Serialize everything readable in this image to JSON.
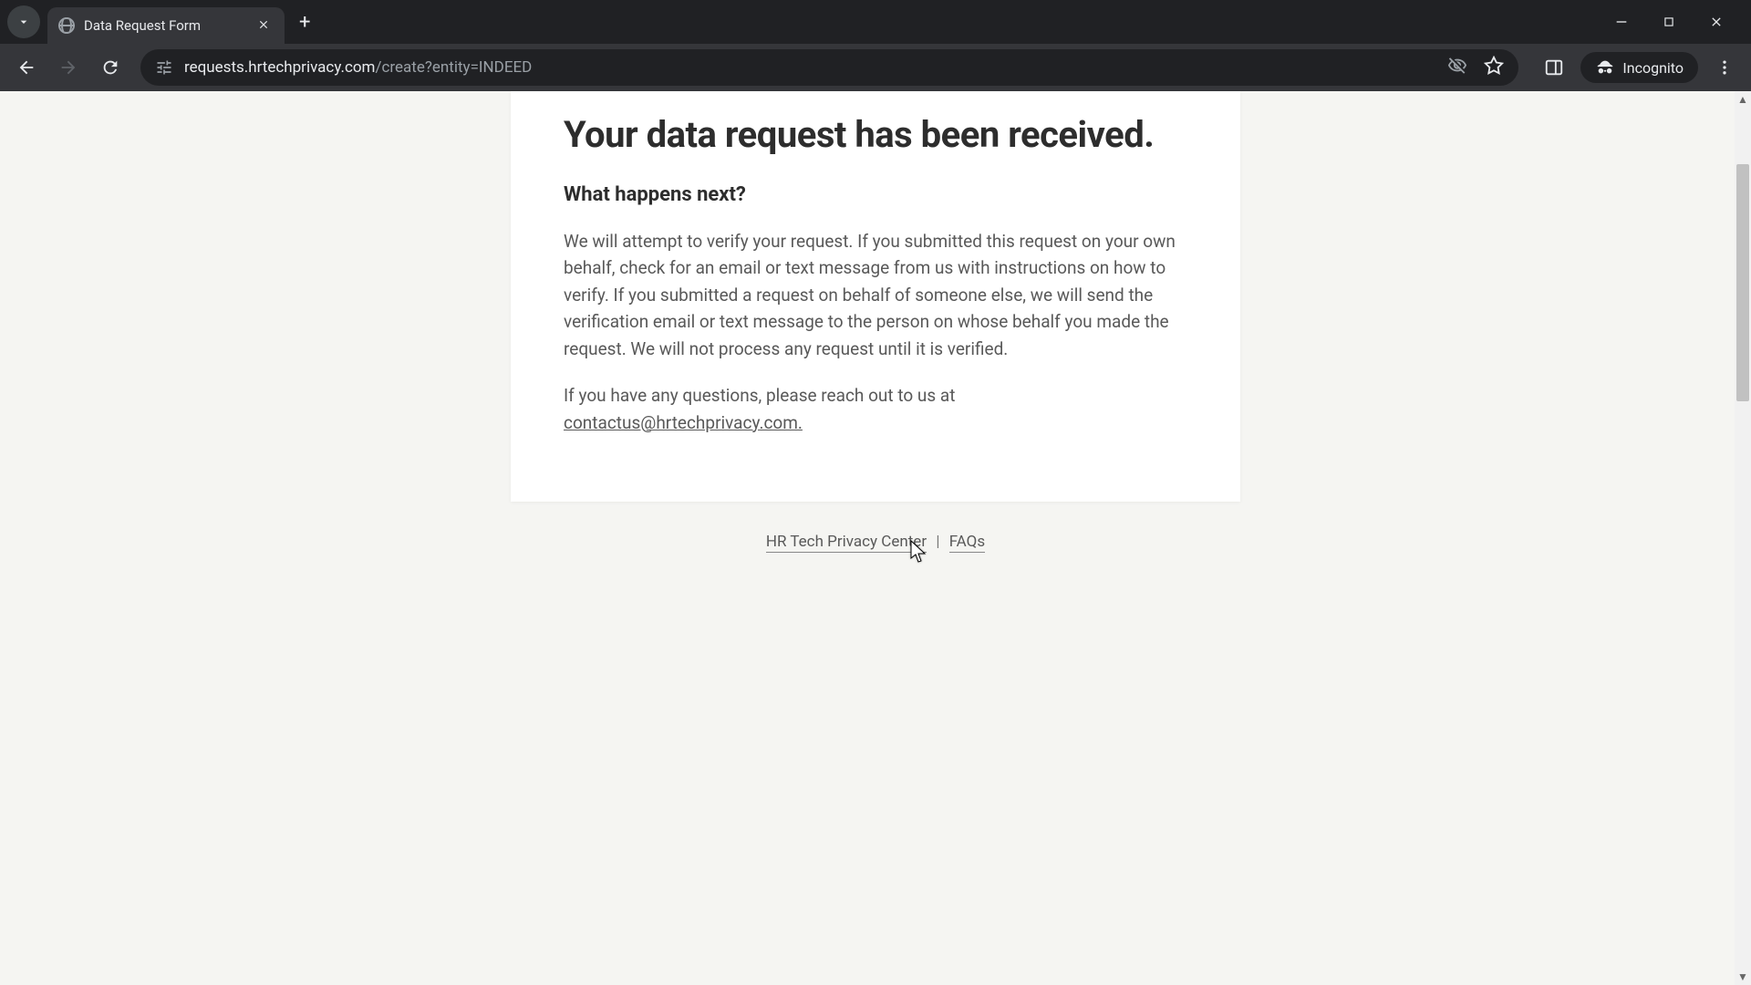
{
  "browser": {
    "tab_title": "Data Request Form",
    "new_tab_label": "+",
    "url_host": "requests.hrtechprivacy.com",
    "url_path": "/create?entity=INDEED",
    "incognito_label": "Incognito"
  },
  "page": {
    "heading": "Your data request has been received.",
    "subheading": "What happens next?",
    "paragraph1": "We will attempt to verify your request. If you submitted this request on your own behalf, check for an email or text message from us with instructions on how to verify. If you submitted a request on behalf of someone else, we will send the verification email or text message to the person on whose behalf you made the request. We will not process any request until it is verified.",
    "paragraph2_prefix": "If you have any questions, please reach out to us at ",
    "contact_email": "contactus@hrtechprivacy.com.",
    "footer": {
      "link1": "HR Tech Privacy Center",
      "separator": "|",
      "link2": "FAQs"
    }
  }
}
